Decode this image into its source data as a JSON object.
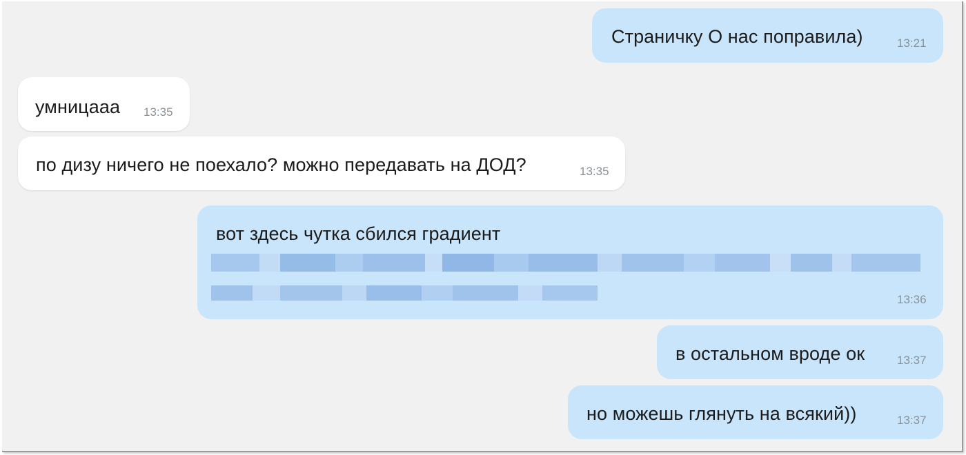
{
  "messages": [
    {
      "direction": "outgoing",
      "text": "Страничку О нас поправила)",
      "time": "13:21"
    },
    {
      "direction": "incoming",
      "text": "умницааа",
      "time": "13:35"
    },
    {
      "direction": "incoming",
      "text": "по дизу ничего не поехало? можно передавать на ДОД?",
      "time": "13:35"
    },
    {
      "direction": "outgoing",
      "text": "вот здесь чутка сбился градиент",
      "time": "13:36",
      "redacted_content": true
    },
    {
      "direction": "outgoing",
      "text": "в остальном вроде ок",
      "time": "13:37"
    },
    {
      "direction": "outgoing",
      "text": "но можешь глянуть на всякий))",
      "time": "13:37"
    }
  ],
  "colors": {
    "background": "#f1f1f1",
    "incoming_bubble": "#ffffff",
    "outgoing_bubble": "#c9e5fb",
    "text": "#1b1b1b",
    "timestamp": "#8a9299",
    "redacted_pixel": "#8fb6e3"
  }
}
